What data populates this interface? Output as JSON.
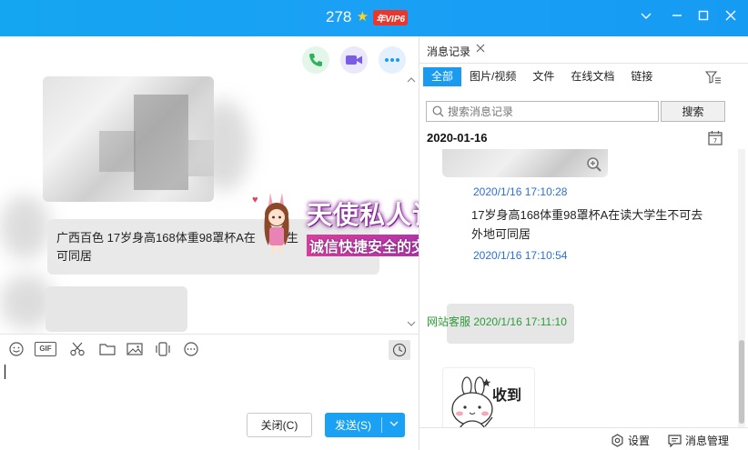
{
  "titlebar": {
    "title_number": "278",
    "vip_badge": "年VIP6",
    "icons": [
      "star-icon",
      "chevron-down-icon",
      "minimize-icon",
      "maximize-icon",
      "close-icon"
    ]
  },
  "chat": {
    "call_icons": [
      "phone-icon",
      "video-call-icon",
      "more-icon"
    ],
    "text_message_line1": "广西百色 17岁身高168体重98罩杯A在",
    "text_message_line1_tail": "生",
    "text_message_line2": "可同居"
  },
  "watermark": {
    "title": "天使私人订制",
    "subtitle": "诚信快捷安全的交友平台"
  },
  "toolbar": {
    "gif_label": "GIF",
    "icons": [
      "emoji-icon",
      "gif-icon",
      "scissors-icon",
      "folder-icon",
      "image-icon",
      "shake-icon",
      "more-icon",
      "clock-icon"
    ]
  },
  "input": {
    "close_label": "关闭(C)",
    "send_label": "发送(S)"
  },
  "history": {
    "tab_label": "消息记录",
    "filters": [
      "全部",
      "图片/视频",
      "文件",
      "在线文档",
      "链接"
    ],
    "search_placeholder": "搜索消息记录",
    "search_button": "搜索",
    "date": "2020-01-16",
    "calendar_day": "7",
    "messages": [
      {
        "time": "2020/1/16 17:10:28",
        "text": "17岁身高168体重98罩杯A在读大学生不可去",
        "text_cont": "外地可同居"
      },
      {
        "time": "2020/1/16 17:10:54"
      },
      {
        "sender": "网站客服",
        "time": "2020/1/16 17:11:10",
        "sticker_text": "收到"
      }
    ],
    "settings_label": "设置",
    "manage_label": "消息管理"
  },
  "colors": {
    "accent": "#1aa1f4",
    "vip_red": "#e8372c",
    "history_time_blue": "#2a6fd6",
    "sender_green": "#2e9a3a"
  }
}
